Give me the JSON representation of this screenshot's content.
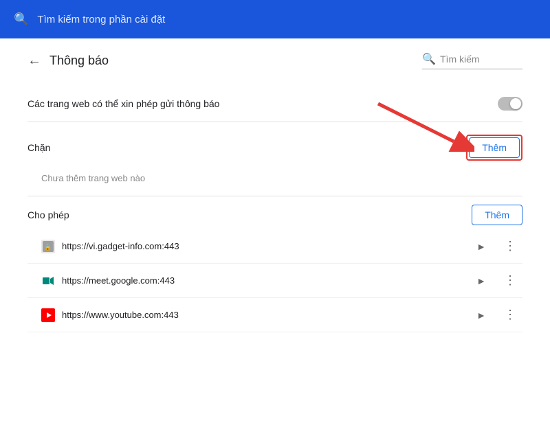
{
  "topBar": {
    "searchPlaceholder": "Tìm kiếm trong phần cài đặt"
  },
  "header": {
    "backLabel": "←",
    "title": "Thông báo",
    "searchPlaceholder": "Tìm kiếm"
  },
  "toggleSection": {
    "label": "Các trang web có thể xin phép gửi thông báo"
  },
  "blockedSection": {
    "label": "Chặn",
    "addButton": "Thêm",
    "emptyText": "Chưa thêm trang web nào"
  },
  "allowedSection": {
    "label": "Cho phép",
    "addButton": "Thêm"
  },
  "sites": [
    {
      "url": "https://vi.gadget-info.com:443",
      "faviconType": "gadget",
      "faviconSymbol": "🔒"
    },
    {
      "url": "https://meet.google.com:443",
      "faviconType": "meet",
      "faviconSymbol": "📅"
    },
    {
      "url": "https://www.youtube.com:443",
      "faviconType": "youtube",
      "faviconSymbol": "▶"
    }
  ]
}
